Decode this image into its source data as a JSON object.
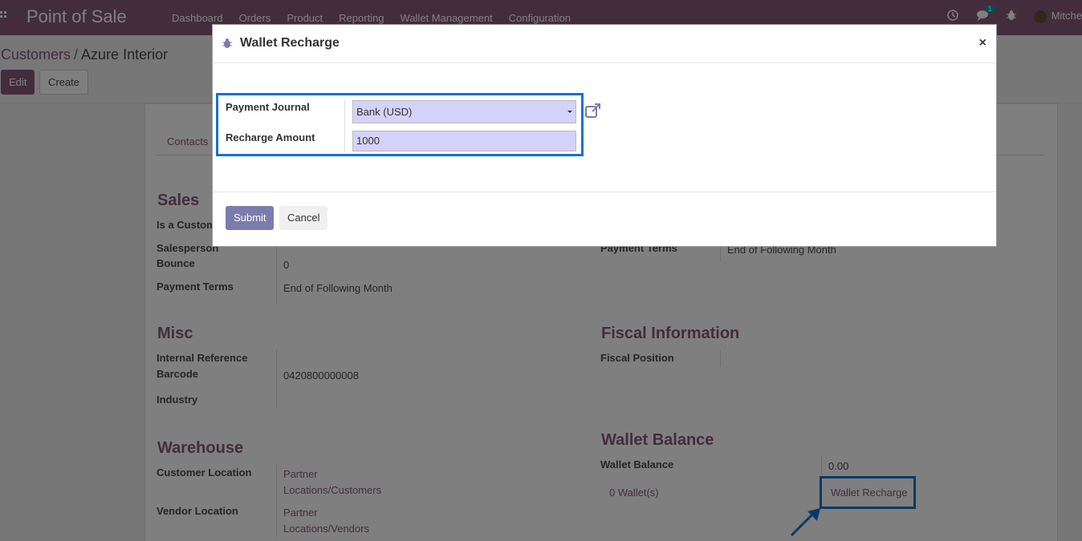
{
  "navbar": {
    "brand": "Point of Sale",
    "menu": [
      "Dashboard",
      "Orders",
      "Product",
      "Reporting",
      "Wallet Management",
      "Configuration"
    ],
    "chat_badge": "1",
    "user": "Mitche"
  },
  "control_panel": {
    "breadcrumb_parent": "Customers",
    "breadcrumb_sep": "/",
    "breadcrumb_current": "Azure Interior",
    "edit_label": "Edit",
    "create_label": "Create"
  },
  "form": {
    "tab_contacts": "Contacts",
    "sales": {
      "heading": "Sales",
      "is_customer_label": "Is a Customer",
      "salesperson_label": "Salesperson",
      "bounce_label": "Bounce",
      "bounce_value": "0",
      "payment_terms_label": "Payment Terms",
      "payment_terms_value": "End of Following Month"
    },
    "purchase": {
      "payment_terms_label": "Payment Terms",
      "payment_terms_value": "End of Following Month"
    },
    "misc": {
      "heading": "Misc",
      "internal_ref_label": "Internal Reference",
      "barcode_label": "Barcode",
      "barcode_value": "0420800000008",
      "industry_label": "Industry"
    },
    "fiscal": {
      "heading": "Fiscal Information",
      "fiscal_position_label": "Fiscal Position"
    },
    "warehouse": {
      "heading": "Warehouse",
      "customer_location_label": "Customer Location",
      "customer_location_line1": "Partner",
      "customer_location_line2": "Locations/Customers",
      "vendor_location_label": "Vendor Location",
      "vendor_location_line1": "Partner",
      "vendor_location_line2": "Locations/Vendors"
    },
    "wallet": {
      "heading": "Wallet Balance",
      "balance_label": "Wallet Balance",
      "balance_value": "0.00",
      "wallets_link": "0 Wallet(s)",
      "recharge_link": "Wallet Recharge"
    }
  },
  "modal": {
    "title": "Wallet Recharge",
    "close": "×",
    "payment_journal_label": "Payment Journal",
    "payment_journal_value": "Bank (USD)",
    "recharge_amount_label": "Recharge Amount",
    "recharge_amount_value": "1000",
    "submit_label": "Submit",
    "cancel_label": "Cancel"
  },
  "colors": {
    "brand": "#875a7b",
    "highlight": "#1572d1",
    "field_bg": "#d4d2f8",
    "submit": "#7c7bad"
  }
}
